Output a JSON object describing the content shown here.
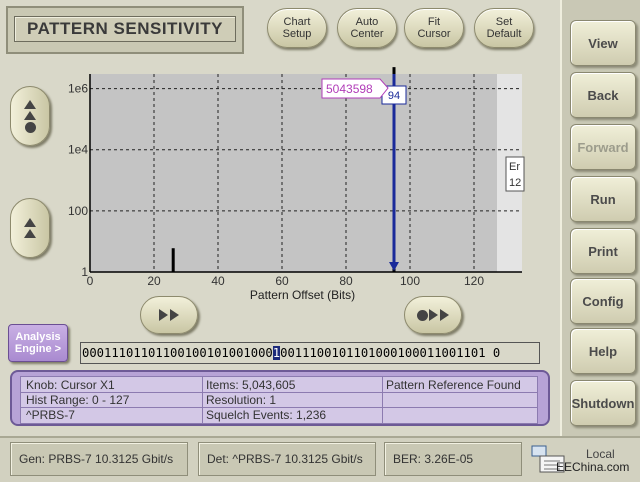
{
  "title": "PATTERN SENSITIVITY",
  "top_buttons": [
    "Chart\nSetup",
    "Auto\nCenter",
    "Fit\nCursor",
    "Set\nDefault"
  ],
  "side_buttons": [
    {
      "label": "View",
      "enabled": true
    },
    {
      "label": "Back",
      "enabled": true
    },
    {
      "label": "Forward",
      "enabled": false
    },
    {
      "label": "Run",
      "enabled": true
    },
    {
      "label": "Print",
      "enabled": true
    },
    {
      "label": "Config",
      "enabled": true
    },
    {
      "label": "Help",
      "enabled": true
    },
    {
      "label": "Shutdown",
      "enabled": true
    }
  ],
  "analysis_engine_label": "Analysis\nEngine >",
  "pattern": {
    "before": "00011101101100100101001000",
    "cursor_bit": "1",
    "after": "0011100101101000100011001101 0"
  },
  "info": {
    "knob": "Knob:  Cursor X1",
    "hist_range": "Hist Range: 0 - 127",
    "pattern_name": "^PRBS-7",
    "items": "Items: 5,043,605",
    "resolution": "Resolution: 1",
    "squelch": "Squelch Events: 1,236",
    "status": "Pattern Reference Found"
  },
  "status": {
    "gen": "Gen: PRBS-7 10.3125 Gbit/s",
    "det": "Det: ^PRBS-7 10.3125 Gbit/s",
    "ber": "BER: 3.26E-05",
    "local": "Local",
    "watermark": "EEChina.com"
  },
  "chart_data": {
    "type": "bar",
    "xlabel": "Pattern Offset (Bits)",
    "ylabel": "",
    "xlim": [
      0,
      135
    ],
    "x_ticks": [
      0,
      20,
      40,
      60,
      80,
      100,
      120
    ],
    "ylog": true,
    "ylim": [
      1,
      3000000
    ],
    "y_ticks": [
      "1",
      "100",
      "1e4",
      "1e6"
    ],
    "grid": true,
    "bars": [
      {
        "x": 26,
        "y": 6
      },
      {
        "x": 95,
        "y": 5043598
      }
    ],
    "cursor": {
      "x": 95,
      "value_label": "5043598",
      "x_label": "94"
    },
    "offscreen_label": [
      "Er",
      "12"
    ],
    "colors": {
      "bar": "#000000",
      "cursor": "#1a2a9a",
      "label": "#b13cb8"
    }
  }
}
